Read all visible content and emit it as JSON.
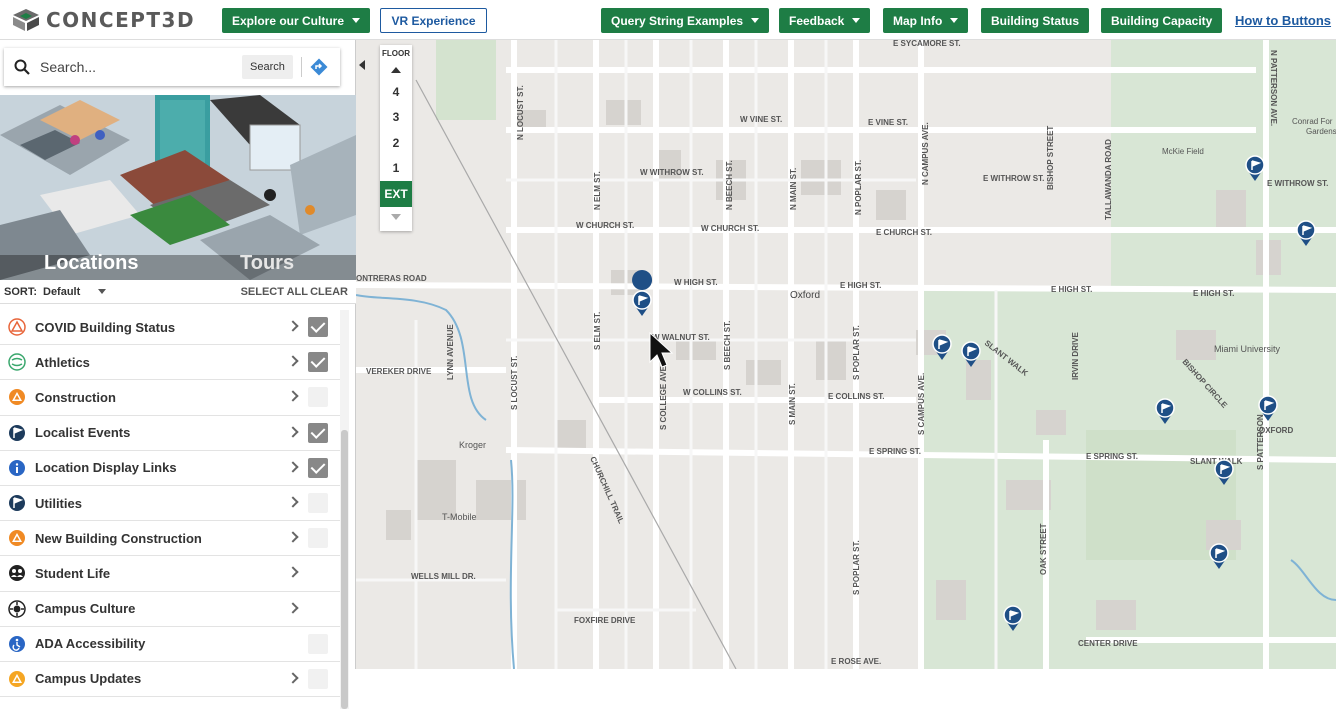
{
  "app": {
    "logo_text": "CONCEPT3D"
  },
  "toolbar": {
    "explore": "Explore our Culture",
    "vr": "VR Experience",
    "query": "Query String Examples",
    "feedback": "Feedback",
    "map_info": "Map Info",
    "building_status": "Building Status",
    "building_capacity": "Building Capacity",
    "how_to": "How to Buttons"
  },
  "search": {
    "placeholder": "Search...",
    "button": "Search"
  },
  "hero": {
    "tab_locations": "Locations",
    "tab_tours": "Tours"
  },
  "sort": {
    "label": "SORT:",
    "value": "Default",
    "select_all": "SELECT ALL",
    "clear": "CLEAR"
  },
  "categories": [
    {
      "label": "COVID Building Status",
      "icon": "warning-icon",
      "color": "#e8653a",
      "chevron": true,
      "checked": true
    },
    {
      "label": "Athletics",
      "icon": "athletics-icon",
      "color": "#3aa76d",
      "chevron": true,
      "checked": true
    },
    {
      "label": "Construction",
      "icon": "construction-icon",
      "color": "#f08a24",
      "chevron": true,
      "checked": false
    },
    {
      "label": "Localist Events",
      "icon": "flag-icon",
      "color": "#1d3b5c",
      "chevron": true,
      "checked": true
    },
    {
      "label": "Location Display Links",
      "icon": "info-icon",
      "color": "#2a66c4",
      "chevron": true,
      "checked": true
    },
    {
      "label": "Utilities",
      "icon": "flag-icon",
      "color": "#1d3b5c",
      "chevron": true,
      "checked": false
    },
    {
      "label": "New Building Construction",
      "icon": "construction-icon",
      "color": "#f08a24",
      "chevron": true,
      "checked": false
    },
    {
      "label": "Student Life",
      "icon": "people-icon",
      "color": "#222222",
      "chevron": true,
      "checked": null
    },
    {
      "label": "Campus Culture",
      "icon": "culture-icon",
      "color": "#222222",
      "chevron": true,
      "checked": null
    },
    {
      "label": "ADA Accessibility",
      "icon": "accessibility-icon",
      "color": "#2a66c4",
      "chevron": false,
      "checked": false
    },
    {
      "label": "Campus Updates",
      "icon": "construction-icon",
      "color": "#f5a623",
      "chevron": true,
      "checked": false
    }
  ],
  "floor_selector": {
    "title": "FLOOR",
    "floors": [
      "4",
      "3",
      "2",
      "1",
      "EXT"
    ],
    "active": "EXT"
  },
  "map_labels": {
    "oxford": "Oxford",
    "miami": "Miami University",
    "mckie": "McKie Field",
    "conrad": "Conrad For",
    "gardens": "Gardens",
    "kroger": "Kroger",
    "tmobile": "T-Mobile",
    "sycamore": "E SYCAMORE ST.",
    "w_vine": "W VINE ST.",
    "e_vine": "E VINE ST.",
    "w_withrow": "W WITHROW ST.",
    "e_withrow": "E WITHROW ST.",
    "e_withrow2": "E WITHROW ST.",
    "w_church": "W CHURCH ST.",
    "w_church2": "W CHURCH ST.",
    "e_church": "E CHURCH ST.",
    "w_high": "W HIGH ST.",
    "e_high": "E HIGH ST.",
    "e_high2": "E HIGH ST.",
    "e_high3": "E HIGH ST.",
    "w_walnut": "W WALNUT ST.",
    "w_collins": "W COLLINS ST.",
    "e_collins": "E COLLINS ST.",
    "e_spring": "E SPRING ST.",
    "e_spring2": "E SPRING ST.",
    "slant_walk": "SLANT WALK",
    "slant_walk2": "SLANT WALK",
    "oxford_right": "OXFORD",
    "contreras": "ONTRERAS ROAD",
    "vereker": "VEREKER DRIVE",
    "wells_mill": "WELLS MILL DR.",
    "foxfire": "FOXFIRE DRIVE",
    "center_drive": "CENTER DRIVE",
    "e_rose": "E ROSE AVE.",
    "n_locust": "N LOCUST ST.",
    "s_locust": "S LOCUST ST.",
    "n_elm": "N ELM ST.",
    "s_elm": "S ELM ST.",
    "n_beech": "N BEECH ST.",
    "s_beech": "S BEECH ST.",
    "n_main": "N MAIN ST.",
    "s_main": "S MAIN ST.",
    "n_poplar": "N POPLAR ST.",
    "s_poplar": "S POPLAR ST.",
    "s_poplar2": "S POPLAR ST.",
    "n_campus": "N CAMPUS AVE.",
    "s_campus": "S CAMPUS AVE.",
    "bishop": "BISHOP STREET",
    "tallawanda": "TALLAWANDA ROAD",
    "s_college": "S COLLEGE AVE.",
    "lynn": "LYNN AVENUE",
    "churchill": "CHURCHILL TRAIL",
    "irvin": "IRVIN DRIVE",
    "bishop_circle": "BISHOP CIRCLE",
    "oak": "OAK STREET",
    "n_patterson": "N PATTERSON AVE.",
    "s_patterson": "S PATTERSON"
  },
  "colors": {
    "brand_green": "#1e7d45",
    "link_blue": "#1e5aa0",
    "pin_blue": "#1f4f86"
  }
}
